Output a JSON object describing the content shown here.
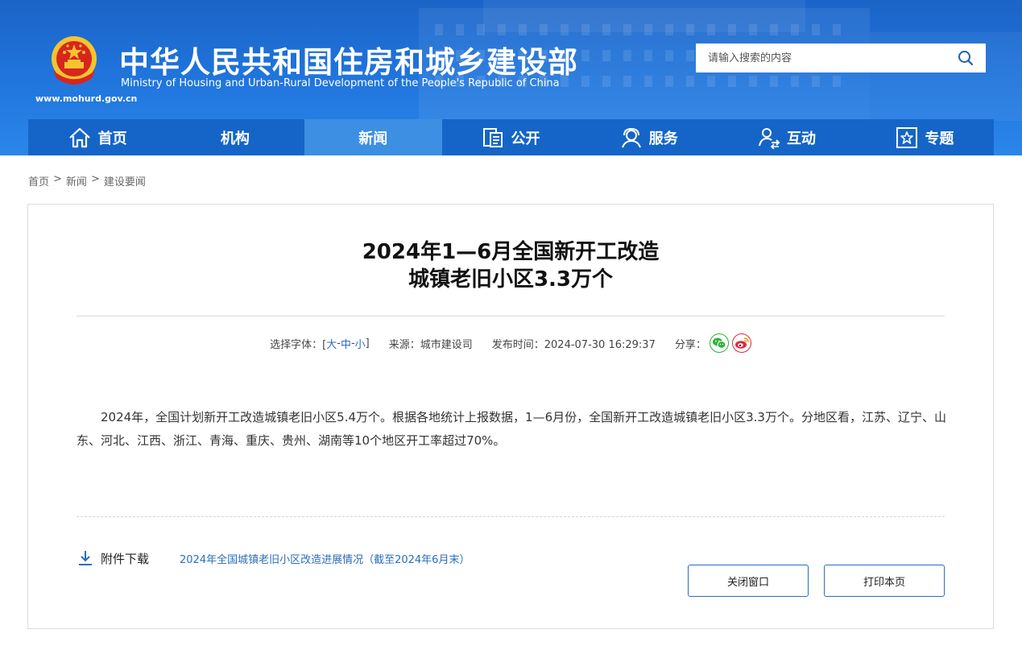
{
  "header": {
    "title_cn": "中华人民共和国住房和城乡建设部",
    "title_en": "Ministry of Housing and Urban-Rural Development of the People's Republic of China",
    "url": "www.mohurd.gov.cn",
    "emblem_icon": "national-emblem-icon"
  },
  "search": {
    "placeholder": "请输入搜索的内容",
    "icon": "search-icon"
  },
  "nav": {
    "items": [
      {
        "label": "首页",
        "icon": "home-icon"
      },
      {
        "label": "机构"
      },
      {
        "label": "新闻",
        "active": true
      },
      {
        "label": "公开",
        "icon": "document-icon"
      },
      {
        "label": "服务",
        "icon": "service-icon"
      },
      {
        "label": "互动",
        "icon": "interact-icon"
      },
      {
        "label": "专题",
        "icon": "star-icon"
      }
    ]
  },
  "breadcrumb": [
    "首页",
    "新闻",
    "建设要闻"
  ],
  "breadcrumb_sep": ">",
  "article": {
    "title_line1": "2024年1—6月全国新开工改造",
    "title_line2": "城镇老旧小区3.3万个",
    "meta": {
      "font_label": "选择字体：[",
      "font_large": "大",
      "font_medium": "中",
      "font_small": "小",
      "font_sep": "-",
      "font_close": "]",
      "source": "来源：城市建设司",
      "date": "发布时间：2024-07-30 16:29:37",
      "share_label": "分享："
    },
    "body": "2024年，全国计划新开工改造城镇老旧小区5.4万个。根据各地统计上报数据，1—6月份，全国新开工改造城镇老旧小区3.3万个。分地区看，江苏、辽宁、山东、河北、江西、浙江、青海、重庆、贵州、湖南等10个地区开工率超过70%。",
    "attachment_label": "附件下载",
    "attachment_link": "2024年全国城镇老旧小区改造进展情况（截至2024年6月末）"
  },
  "buttons": {
    "close": "关闭窗口",
    "print": "打印本页"
  },
  "colors": {
    "header_blue": "#1f73da",
    "nav_blue": "#1565c8",
    "nav_active": "#3c8fe3",
    "link_blue": "#2b6db8",
    "wechat_green": "#2db23d",
    "weibo_red": "#e0283e"
  }
}
